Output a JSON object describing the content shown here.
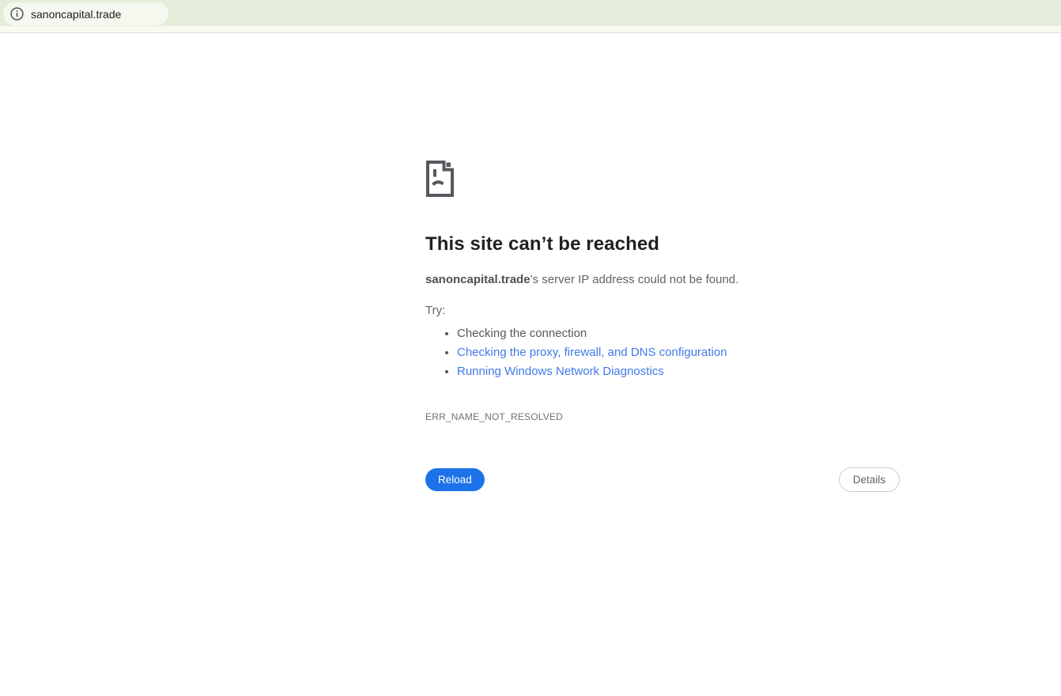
{
  "browser": {
    "url": "sanoncapital.trade",
    "info_icon": "info-icon"
  },
  "error_page": {
    "icon": "sad-page-icon",
    "title": "This site can’t be reached",
    "message_domain": "sanoncapital.trade",
    "message_rest": "’s server IP address could not be found.",
    "try_label": "Try:",
    "suggestions": [
      {
        "label": "Checking the connection",
        "is_link": false
      },
      {
        "label": "Checking the proxy, firewall, and DNS configuration",
        "is_link": true
      },
      {
        "label": "Running Windows Network Diagnostics",
        "is_link": true
      }
    ],
    "error_code": "ERR_NAME_NOT_RESOLVED",
    "reload_label": "Reload",
    "details_label": "Details"
  },
  "colors": {
    "topbar_bg": "#e4edda",
    "topbar_strip_bg": "#f8faef",
    "url_pill_bg": "#f4f8ee",
    "link_blue": "#4178e8",
    "reload_button_bg": "#1c72e8",
    "icon_gray": "#55585c",
    "heading_text": "#202124",
    "body_text": "#5f6368"
  }
}
